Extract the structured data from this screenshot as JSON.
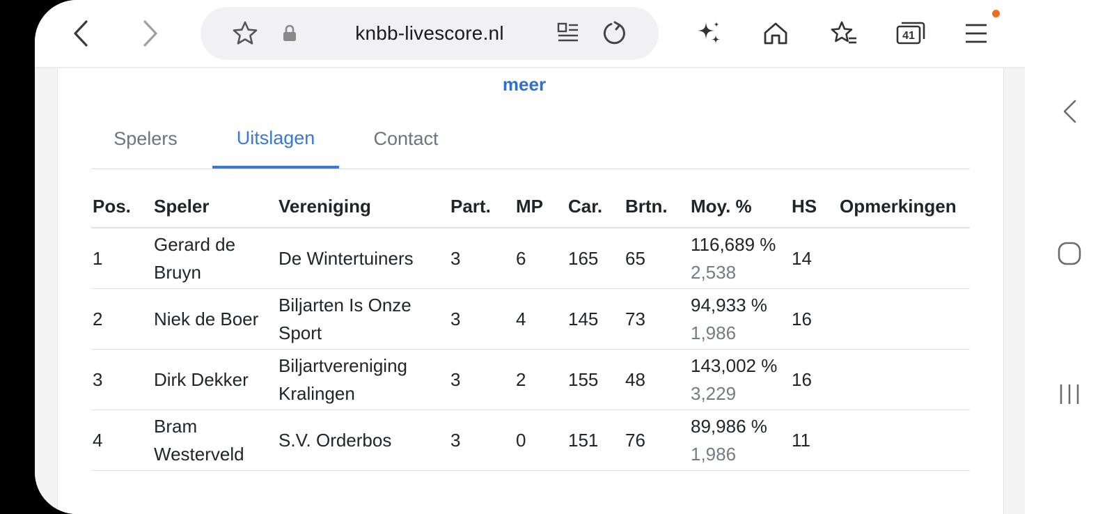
{
  "browser": {
    "url": "knbb-livescore.nl",
    "tab_count": "41"
  },
  "page": {
    "more_link": "meer",
    "tabs": [
      {
        "label": "Spelers",
        "active": false
      },
      {
        "label": "Uitslagen",
        "active": true
      },
      {
        "label": "Contact",
        "active": false
      }
    ]
  },
  "results": {
    "headers": [
      "Pos.",
      "Speler",
      "Vereniging",
      "Part.",
      "MP",
      "Car.",
      "Brtn.",
      "Moy. %",
      "HS",
      "Opmerkingen"
    ],
    "rows": [
      {
        "pos": "1",
        "speler": "Gerard de Bruyn",
        "vereniging": "De Wintertuiners",
        "part": "3",
        "mp": "6",
        "car": "165",
        "brtn": "65",
        "moy_pct": "116,689 %",
        "moy": "2,538",
        "hs": "14",
        "opmerkingen": ""
      },
      {
        "pos": "2",
        "speler": "Niek de Boer",
        "vereniging": "Biljarten Is Onze Sport",
        "part": "3",
        "mp": "4",
        "car": "145",
        "brtn": "73",
        "moy_pct": "94,933 %",
        "moy": "1,986",
        "hs": "16",
        "opmerkingen": ""
      },
      {
        "pos": "3",
        "speler": "Dirk Dekker",
        "vereniging": "Biljartvereniging Kralingen",
        "part": "3",
        "mp": "2",
        "car": "155",
        "brtn": "48",
        "moy_pct": "143,002 %",
        "moy": "3,229",
        "hs": "16",
        "opmerkingen": ""
      },
      {
        "pos": "4",
        "speler": "Bram Westerveld",
        "vereniging": "S.V. Orderbos",
        "part": "3",
        "mp": "0",
        "car": "151",
        "brtn": "76",
        "moy_pct": "89,986 %",
        "moy": "1,986",
        "hs": "11",
        "opmerkingen": ""
      }
    ]
  },
  "icons": {
    "back": "back-arrow-icon",
    "forward": "forward-arrow-icon",
    "bookmark": "star-icon",
    "lock": "lock-icon",
    "reader": "reader-mode-icon",
    "reload": "reload-icon",
    "ai": "sparkle-icon",
    "home": "home-icon",
    "bookmarks": "bookmarks-icon",
    "tabs": "tabs-icon",
    "menu": "menu-icon"
  },
  "colors": {
    "accent": "#3a78d6",
    "link": "#2f6fce",
    "notification": "#f26b22"
  }
}
